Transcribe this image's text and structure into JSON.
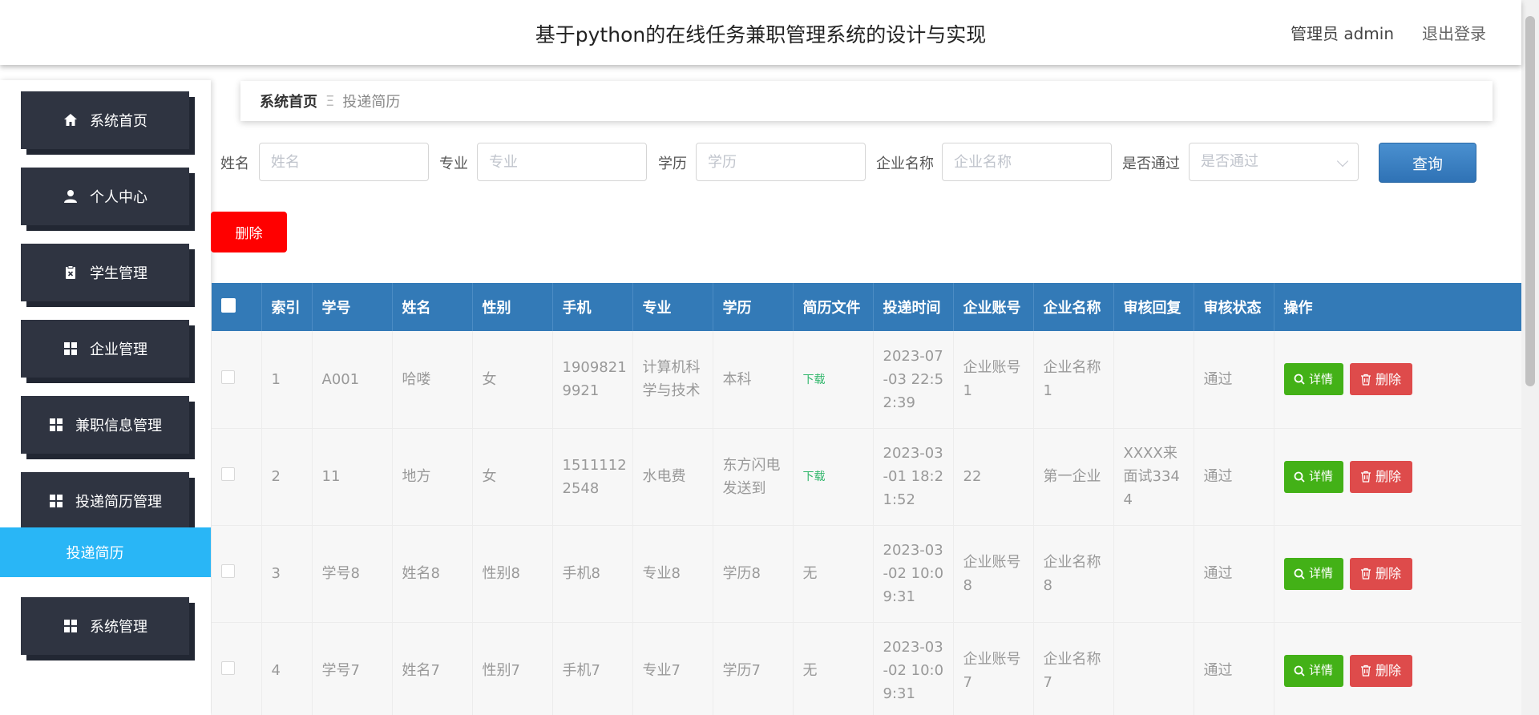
{
  "header": {
    "title": "基于python的在线任务兼职管理系统的设计与实现",
    "user": "管理员 admin",
    "logout": "退出登录"
  },
  "sidebar": {
    "items": [
      {
        "label": "系统首页",
        "icon": "home-icon"
      },
      {
        "label": "个人中心",
        "icon": "user-icon"
      },
      {
        "label": "学生管理",
        "icon": "clipboard-icon"
      },
      {
        "label": "企业管理",
        "icon": "grid-icon"
      },
      {
        "label": "兼职信息管理",
        "icon": "grid-icon"
      },
      {
        "label": "投递简历管理",
        "icon": "grid-icon"
      },
      {
        "label": "系统管理",
        "icon": "grid-icon"
      }
    ],
    "submenu_active": "投递简历"
  },
  "breadcrumb": {
    "home": "系统首页",
    "separator": "Ξ",
    "current": "投递简历"
  },
  "search": {
    "name_label": "姓名",
    "name_placeholder": "姓名",
    "major_label": "专业",
    "major_placeholder": "专业",
    "edu_label": "学历",
    "edu_placeholder": "学历",
    "company_label": "企业名称",
    "company_placeholder": "企业名称",
    "passed_label": "是否通过",
    "passed_placeholder": "是否通过",
    "query_button": "查询"
  },
  "actions": {
    "delete_button": "删除"
  },
  "table": {
    "headers": [
      "索引",
      "学号",
      "姓名",
      "性别",
      "手机",
      "专业",
      "学历",
      "简历文件",
      "投递时间",
      "企业账号",
      "企业名称",
      "审核回复",
      "审核状态",
      "操作"
    ],
    "detail_label": "详情",
    "delete_label": "删除",
    "rows": [
      {
        "index": "1",
        "student_no": "A001",
        "name": "哈喽",
        "gender": "女",
        "phone": "19098219921",
        "major": "计算机科学与技术",
        "education": "本科",
        "resume": "下载",
        "time": "2023-07-03 22:52:39",
        "company_account": "企业账号1",
        "company_name": "企业名称1",
        "reply": "",
        "status": "通过"
      },
      {
        "index": "2",
        "student_no": "11",
        "name": "地方",
        "gender": "女",
        "phone": "15111122548",
        "major": "水电费",
        "education": "东方闪电发送到",
        "resume": "下载",
        "time": "2023-03-01 18:21:52",
        "company_account": "22",
        "company_name": "第一企业",
        "reply": "XXXX来面试3344",
        "status": "通过"
      },
      {
        "index": "3",
        "student_no": "学号8",
        "name": "姓名8",
        "gender": "性别8",
        "phone": "手机8",
        "major": "专业8",
        "education": "学历8",
        "resume": "无",
        "time": "2023-03-02 10:09:31",
        "company_account": "企业账号8",
        "company_name": "企业名称8",
        "reply": "",
        "status": "通过"
      },
      {
        "index": "4",
        "student_no": "学号7",
        "name": "姓名7",
        "gender": "性别7",
        "phone": "手机7",
        "major": "专业7",
        "education": "学历7",
        "resume": "无",
        "time": "2023-03-02 10:09:31",
        "company_account": "企业账号7",
        "company_name": "企业名称7",
        "reply": "",
        "status": "通过"
      }
    ]
  },
  "colors": {
    "sidebar_button": "#2f3441",
    "active_submenu": "#29b6f6",
    "table_header": "#337ab7",
    "query_button": "#3a82c4",
    "delete_button": "#ff0000",
    "detail_button": "#43b117",
    "row_delete_button": "#de4b4b",
    "download_link": "#2fb66a"
  }
}
